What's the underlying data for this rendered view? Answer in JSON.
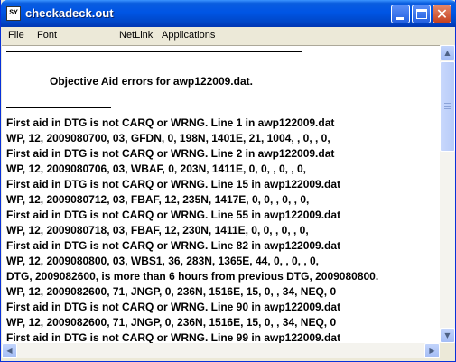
{
  "window": {
    "title": "checkadeck.out",
    "icon_label": "SY",
    "close_glyph": "✕"
  },
  "menu": [
    "File",
    "Font",
    "NetLink",
    "Applications"
  ],
  "document": {
    "heading": "Objective Aid errors for awp122009.dat.",
    "lines": [
      "First aid in DTG is not CARQ or WRNG.  Line 1 in awp122009.dat",
      "WP, 12, 2009080700, 03, GFDN,   0, 198N, 1401E,  21, 1004,   ,   0,    ,    0,",
      "First aid in DTG is not CARQ or WRNG.  Line 2 in awp122009.dat",
      "WP, 12, 2009080706, 03, WBAF,   0, 203N, 1411E,   0,    0,   ,   0,    ,    0,",
      "First aid in DTG is not CARQ or WRNG.  Line 15 in awp122009.dat",
      "WP, 12, 2009080712, 03, FBAF,  12, 235N, 1417E,   0,    0,   ,   0,    ,    0,",
      "First aid in DTG is not CARQ or WRNG.  Line 55 in awp122009.dat",
      "WP, 12, 2009080718, 03, FBAF,  12, 230N, 1411E,   0,    0,   ,   0,    ,    0,",
      "First aid in DTG is not CARQ or WRNG.  Line 82 in awp122009.dat",
      "WP, 12, 2009080800, 03, WBS1,  36, 283N, 1365E,  44,    0,   ,   0,    ,    0,",
      "DTG, 2009082600, is more than 6 hours from previous DTG, 2009080800.",
      "WP, 12, 2009082600, 71, JNGP,   0, 236N, 1516E,  15,    0,   , 34, NEQ,    0",
      "First aid in DTG is not CARQ or WRNG.  Line 90 in awp122009.dat",
      "WP, 12, 2009082600, 71, JNGP,   0, 236N, 1516E,  15,    0,   , 34, NEQ,    0",
      "First aid in DTG is not CARQ or WRNG.  Line 99 in awp122009.dat"
    ]
  },
  "scrollbar": {
    "up": "▲",
    "down": "▼",
    "left": "◀",
    "right": "▶"
  }
}
